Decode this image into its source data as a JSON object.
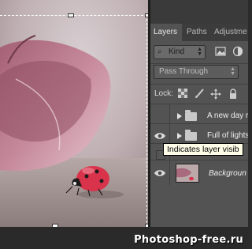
{
  "panel": {
    "tabs": [
      {
        "label": "Layers",
        "active": true
      },
      {
        "label": "Paths",
        "active": false
      },
      {
        "label": "Adjustme",
        "active": false
      }
    ],
    "filter": {
      "kind_label": "Kind",
      "icons": [
        "search-icon",
        "image-filter-icon",
        "adjustment-filter-icon"
      ]
    },
    "blend_mode": "Pass Through",
    "lock": {
      "label": "Lock:",
      "icons": [
        "lock-transparent-icon",
        "lock-brush-icon",
        "lock-move-icon",
        "lock-all-icon"
      ]
    },
    "layers": [
      {
        "name": "A new day r",
        "type": "group",
        "visible": false
      },
      {
        "name": "Full of lights",
        "type": "group",
        "visible": true
      },
      {
        "name": "",
        "type": "layer",
        "visible": false
      },
      {
        "name": "Backgroun",
        "type": "background",
        "visible": true
      }
    ]
  },
  "tooltip": {
    "text": "Indicates layer visib"
  },
  "watermark": "Photoshop-free.ru",
  "colors": {
    "panel_bg": "#535353",
    "tab_bar": "#3c3c3c",
    "tooltip_bg": "#fffde8",
    "ladybug": "#d8334a"
  }
}
